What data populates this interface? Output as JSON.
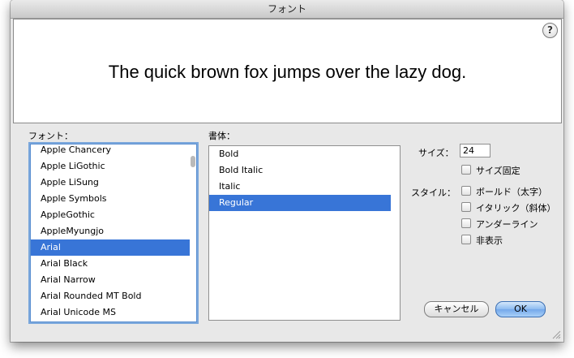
{
  "window": {
    "title": "フォント"
  },
  "preview": {
    "text": "The quick brown fox jumps over the lazy dog.",
    "help_label": "?"
  },
  "font_list": {
    "label": "フォント：",
    "items": [
      "Apple Chancery",
      "Apple LiGothic",
      "Apple LiSung",
      "Apple Symbols",
      "AppleGothic",
      "AppleMyungjo",
      "Arial",
      "Arial Black",
      "Arial Narrow",
      "Arial Rounded MT Bold",
      "Arial Unicode MS"
    ],
    "selected": "Arial"
  },
  "style_list": {
    "label": "書体：",
    "items": [
      "Bold",
      "Bold Italic",
      "Italic",
      "Regular"
    ],
    "selected": "Regular"
  },
  "size": {
    "label": "サイズ：",
    "value": "24",
    "fixed_label": "サイズ固定",
    "fixed_checked": false
  },
  "style_options": {
    "label": "スタイル：",
    "bold": "ボールド（太字）",
    "italic": "イタリック（斜体）",
    "underline": "アンダーライン",
    "hidden": "非表示"
  },
  "buttons": {
    "cancel": "キャンセル",
    "ok": "OK"
  },
  "colors": {
    "selection": "#3875d7",
    "focus_ring": "#7aa7dc"
  }
}
